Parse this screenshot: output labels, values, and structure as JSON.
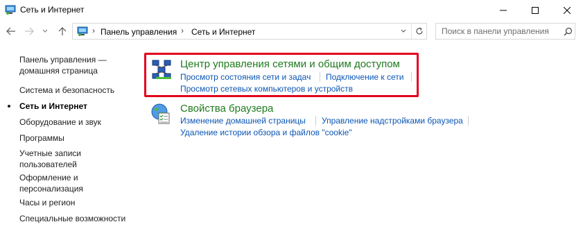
{
  "window": {
    "title": "Сеть и Интернет",
    "controls": {
      "minimize": "—",
      "maximize": "☐",
      "close": "✕"
    }
  },
  "nav": {
    "back_icon": "arrow-left-icon",
    "forward_icon": "arrow-right-icon",
    "up_icon": "arrow-up-icon"
  },
  "address": {
    "separator": "›",
    "crumbs": [
      "Панель управления",
      "Сеть и Интернет"
    ]
  },
  "search": {
    "placeholder": "Поиск в панели управления"
  },
  "sidebar": {
    "items": [
      {
        "label": "Панель управления — домашняя страница"
      },
      {
        "label": "Система и безопасность"
      },
      {
        "label": "Сеть и Интернет",
        "current": true
      },
      {
        "label": "Оборудование и звук"
      },
      {
        "label": "Программы"
      },
      {
        "label": "Учетные записи пользователей"
      },
      {
        "label": "Оформление и персонализация"
      },
      {
        "label": "Часы и регион"
      },
      {
        "label": "Специальные возможности"
      }
    ]
  },
  "categories": [
    {
      "title": "Центр управления сетями и общим доступом",
      "icon": "network-center-icon",
      "links": [
        "Просмотр состояния сети и задач",
        "Подключение к сети",
        "Просмотр сетевых компьютеров и устройств"
      ],
      "highlighted": true
    },
    {
      "title": "Свойства браузера",
      "icon": "internet-options-icon",
      "links": [
        "Изменение домашней страницы",
        "Управление надстройками браузера",
        "Удаление истории обзора и файлов \"cookie\""
      ]
    }
  ],
  "colors": {
    "category_title": "#1e7a1e",
    "link": "#0a55b4",
    "highlight_border": "#e3001b"
  }
}
